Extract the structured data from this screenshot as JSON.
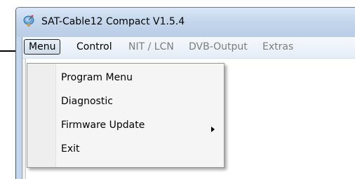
{
  "window": {
    "title": "SAT-Cable12 Compact V1.5.4",
    "app_icon": "satellite-dish-icon"
  },
  "menubar": {
    "items": [
      {
        "label": "Menu",
        "state": "active"
      },
      {
        "label": "Control",
        "state": "enabled"
      },
      {
        "label": "NIT / LCN",
        "state": "disabled"
      },
      {
        "label": "DVB-Output",
        "state": "disabled"
      },
      {
        "label": "Extras",
        "state": "disabled"
      }
    ]
  },
  "dropdown": {
    "items": [
      {
        "label": "Program Menu",
        "has_submenu": false
      },
      {
        "label": "Diagnostic",
        "has_submenu": false
      },
      {
        "label": "Firmware Update",
        "has_submenu": true
      },
      {
        "label": "Exit",
        "has_submenu": false
      }
    ]
  },
  "annotation": {
    "pointer": "arrow-right-icon"
  },
  "colors": {
    "titlebar": "#c4d6ec",
    "menu_bg": "#f5f5f5",
    "disabled_text": "#7d7d7d",
    "active_border": "#262626"
  }
}
